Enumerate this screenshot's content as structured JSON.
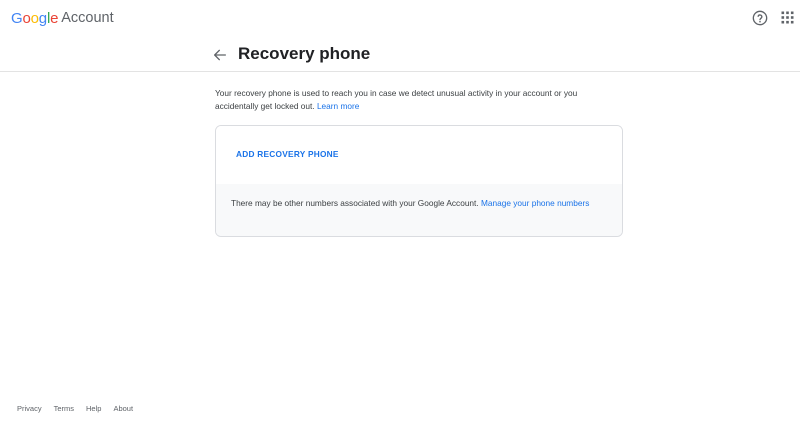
{
  "header": {
    "logo_letters": [
      "G",
      "o",
      "o",
      "g",
      "l",
      "e"
    ],
    "logo_colors": [
      "#4285F4",
      "#EA4335",
      "#FBBC05",
      "#4285F4",
      "#34A853",
      "#EA4335"
    ],
    "product": "Account",
    "help_icon": "help-circle-icon",
    "apps_icon": "apps-grid-icon"
  },
  "titlebar": {
    "back_icon": "arrow-left-icon",
    "title": "Recovery phone"
  },
  "description": {
    "text": "Your recovery phone is used to reach you in case we detect unusual activity in your account or you accidentally get locked out.",
    "link": "Learn more"
  },
  "card": {
    "add_label": "ADD RECOVERY PHONE",
    "other_text": "There may be other numbers associated with your Google Account.",
    "manage_link": "Manage your phone numbers"
  },
  "footer": {
    "privacy": "Privacy",
    "terms": "Terms",
    "help": "Help",
    "about": "About"
  },
  "colors": {
    "accent": "#1a73e8",
    "text": "#202124",
    "secondary": "#5f6368",
    "divider": "#e3e3e3",
    "card_bottom_bg": "#f8f9fa"
  }
}
